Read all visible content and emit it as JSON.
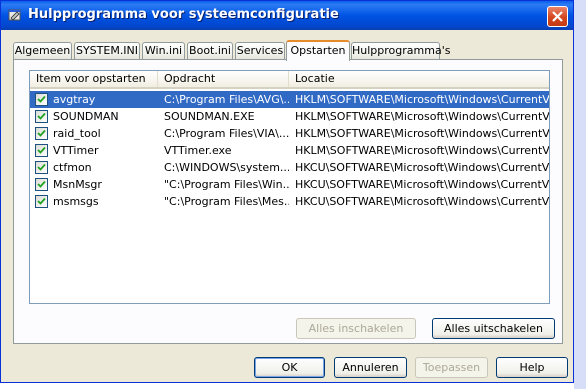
{
  "window": {
    "title": "Hulpprogramma voor systeemconfiguratie"
  },
  "tabs": [
    {
      "label": "Algemeen"
    },
    {
      "label": "SYSTEM.INI"
    },
    {
      "label": "Win.ini"
    },
    {
      "label": "Boot.ini"
    },
    {
      "label": "Services"
    },
    {
      "label": "Opstarten"
    },
    {
      "label": "Hulpprogramma's"
    }
  ],
  "active_tab": "Opstarten",
  "table": {
    "columns": [
      {
        "label": "Item voor opstarten"
      },
      {
        "label": "Opdracht"
      },
      {
        "label": "Locatie"
      }
    ],
    "rows": [
      {
        "checked": true,
        "item": "avgtray",
        "command": "C:\\Program Files\\AVG\\...",
        "location": "HKLM\\SOFTWARE\\Microsoft\\Windows\\CurrentVer...",
        "selected": true
      },
      {
        "checked": true,
        "item": "SOUNDMAN",
        "command": "SOUNDMAN.EXE",
        "location": "HKLM\\SOFTWARE\\Microsoft\\Windows\\CurrentVer...",
        "selected": false
      },
      {
        "checked": true,
        "item": "raid_tool",
        "command": "C:\\Program Files\\VIA\\...",
        "location": "HKLM\\SOFTWARE\\Microsoft\\Windows\\CurrentVer...",
        "selected": false
      },
      {
        "checked": true,
        "item": "VTTimer",
        "command": "VTTimer.exe",
        "location": "HKLM\\SOFTWARE\\Microsoft\\Windows\\CurrentVer...",
        "selected": false
      },
      {
        "checked": true,
        "item": "ctfmon",
        "command": "C:\\WINDOWS\\system...",
        "location": "HKCU\\SOFTWARE\\Microsoft\\Windows\\CurrentVer...",
        "selected": false
      },
      {
        "checked": true,
        "item": "MsnMsgr",
        "command": "\"C:\\Program Files\\Win...",
        "location": "HKCU\\SOFTWARE\\Microsoft\\Windows\\CurrentVer...",
        "selected": false
      },
      {
        "checked": true,
        "item": "msmsgs",
        "command": "\"C:\\Program Files\\Mes...",
        "location": "HKCU\\SOFTWARE\\Microsoft\\Windows\\CurrentVer...",
        "selected": false
      }
    ]
  },
  "buttons": {
    "enable_all": "Alles inschakelen",
    "disable_all": "Alles uitschakelen",
    "ok": "OK",
    "cancel": "Annuleren",
    "apply": "Toepassen",
    "help": "Help"
  },
  "colors": {
    "titlebar": "#0054e3",
    "selection": "#316ac5",
    "active_tab_accent": "#e68b2c",
    "dialog_bg": "#ece9d8"
  },
  "icons": {
    "title": "msconfig-icon",
    "close": "close-icon",
    "checkbox": "checkmark-icon"
  }
}
